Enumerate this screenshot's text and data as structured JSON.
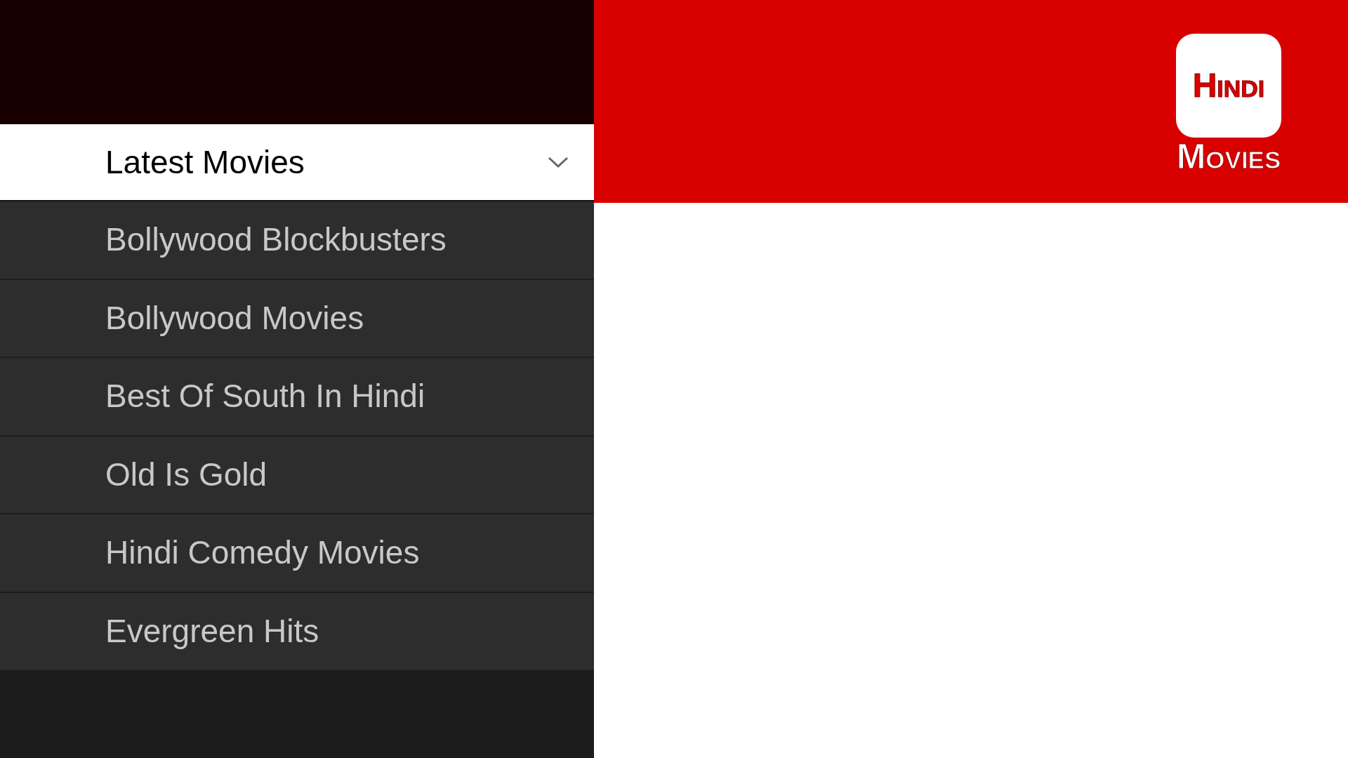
{
  "category_dropdown": {
    "label": "Latest Movies",
    "expanded": true
  },
  "options": [
    {
      "label": "Bollywood Blockbusters"
    },
    {
      "label": "Bollywood Movies"
    },
    {
      "label": "Best Of South In Hindi"
    },
    {
      "label": "Old Is Gold"
    },
    {
      "label": "Hindi Comedy Movies"
    },
    {
      "label": "Evergreen Hits"
    }
  ],
  "logo": {
    "top": "Hindi",
    "bottom": "Movies"
  }
}
